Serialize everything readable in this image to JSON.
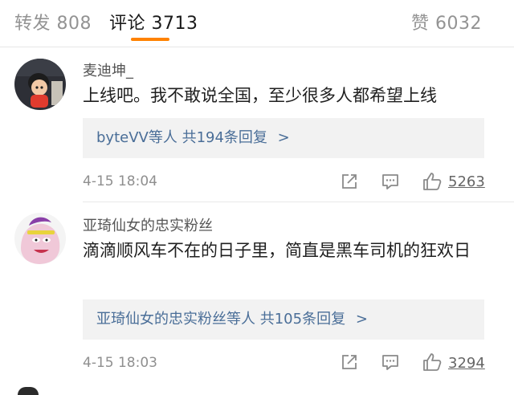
{
  "tabs": {
    "forward": "转发 808",
    "comment": "评论 3713",
    "like": "赞 6032"
  },
  "colors": {
    "accent": "#ff8200",
    "link": "#4a6e98",
    "reply_bg": "#f2f2f2"
  },
  "comments": [
    {
      "username": "麦迪坤_",
      "content": "上线吧。我不敢说全国，至少很多人都希望上线",
      "reply_prefix": "byteVV等人",
      "reply_count": "共194条回复",
      "reply_chevron": ">",
      "time": "4-15 18:04",
      "likes": "5263",
      "icons": [
        "share-icon",
        "comment-icon",
        "thumbs-up-icon"
      ]
    },
    {
      "username": "亚琦仙女的忠实粉丝",
      "content": "滴滴顺风车不在的日子里，简直是黑车司机的狂欢日",
      "reply_prefix": "亚琦仙女的忠实粉丝等人",
      "reply_count": "共105条回复",
      "reply_chevron": ">",
      "time": "4-15 18:03",
      "likes": "3294",
      "icons": [
        "share-icon",
        "comment-icon",
        "thumbs-up-icon"
      ]
    }
  ]
}
